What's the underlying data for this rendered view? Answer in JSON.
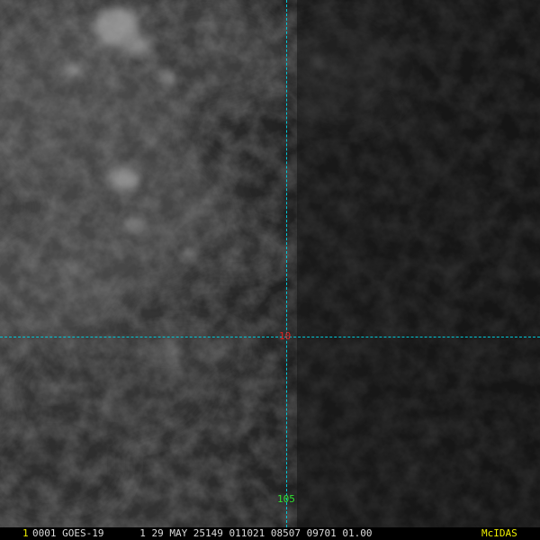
{
  "image": {
    "description_colors": {
      "background": "#141414",
      "cloud_bright": "#8c8c8c",
      "cloud_mid": "#4a4a4a"
    }
  },
  "grid": {
    "lat_label": "10",
    "lon_label": "105",
    "line_color": "#00c8d8",
    "lat_label_color": "#e02020",
    "lon_label_color": "#30e030"
  },
  "status": {
    "frame": "1",
    "text": "0001 GOES-19      1 29 MAY 25149 011021 08507 09701 01.00",
    "brand": "McIDAS",
    "frame_color": "#f0f000",
    "brand_color": "#f0f000"
  }
}
